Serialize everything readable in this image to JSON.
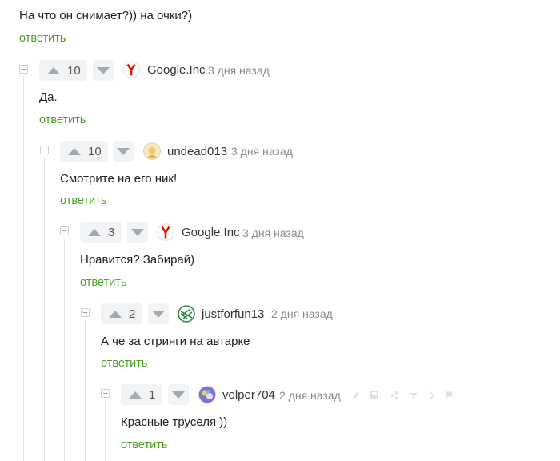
{
  "root_comment": {
    "text": "На что он снимает?)) на очки?)",
    "reply_label": "ответить"
  },
  "comments": [
    {
      "score": "10",
      "user": "Google.Inc",
      "avatar": "yandex-logo",
      "time": "3 дня назад",
      "text": "Да.",
      "reply_label": "ответить"
    },
    {
      "score": "10",
      "user": "undead013",
      "avatar": "user-avatar",
      "time": "3 дня назад",
      "text": "Смотрите на его ник!",
      "reply_label": "ответить"
    },
    {
      "score": "3",
      "user": "Google.Inc",
      "avatar": "yandex-logo",
      "time": "3 дня назад",
      "text": "Нравится? Забирай)",
      "reply_label": "ответить"
    },
    {
      "score": "2",
      "user": "justforfun13",
      "avatar": "user-avatar",
      "time": "2 дня назад",
      "text": "А че за стринги на автарке",
      "reply_label": "ответить"
    },
    {
      "score": "1",
      "user": "volper704",
      "avatar": "user-avatar",
      "time": "2 дня назад",
      "text": "Красные труселя ))",
      "reply_label": "ответить"
    }
  ],
  "colors": {
    "reply_link": "#4b9e2a",
    "vote_bg": "#f2f3f5",
    "arrow": "#a4a9b0",
    "yandex_red": "#e61400"
  }
}
